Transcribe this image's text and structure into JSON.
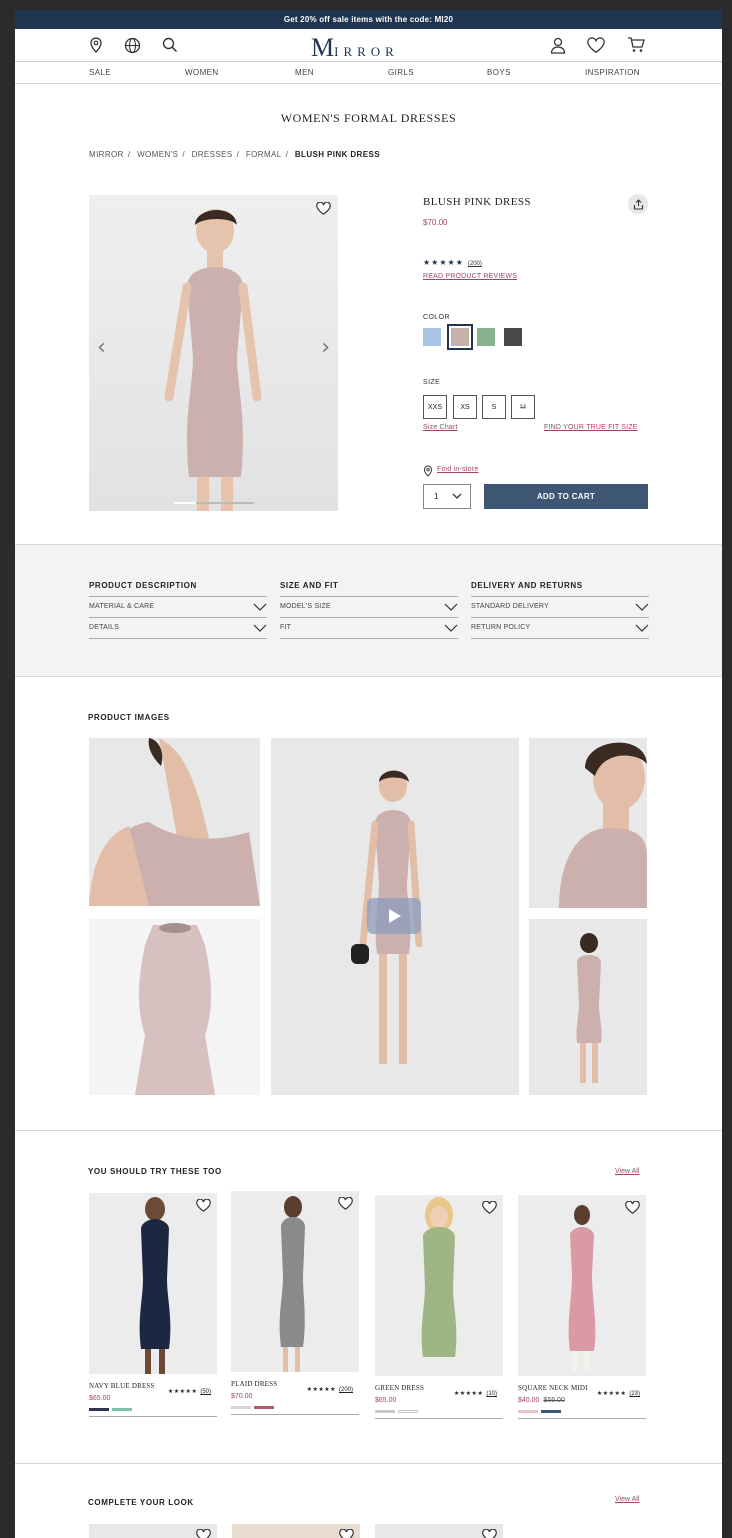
{
  "promo": "Get 20% off sale items with the code: MI20",
  "logo": {
    "initial": "M",
    "rest": "IRROR"
  },
  "nav": [
    "SALE",
    "WOMEN",
    "MEN",
    "GIRLS",
    "BOYS",
    "INSPIRATION"
  ],
  "page_title": "WOMEN'S FORMAL DRESSES",
  "breadcrumbs": [
    "MIRROR",
    "WOMEN'S",
    "DRESSES",
    "FORMAL",
    "BLUSH PINK DRESS"
  ],
  "product": {
    "name": "BLUSH PINK DRESS",
    "price": "$70.00",
    "stars": "★★★★★",
    "review_count": "(200)",
    "reviews_link": "READ PRODUCT REVIEWS",
    "color_label": "COLOR",
    "colors": [
      "#a9c4e4",
      "#c6b2ab",
      "#86b28d",
      "#4a4a4a"
    ],
    "size_label": "SIZE",
    "sizes": [
      "XXS",
      "XS",
      "S",
      "M"
    ],
    "size_chart": "Size Chart",
    "true_fit": "FIND YOUR TRUE FIT SIZE",
    "find_store": "Find in-store",
    "quantity": "1",
    "add_to_cart": "ADD TO CART"
  },
  "info": [
    {
      "heading": "PRODUCT DESCRIPTION",
      "rows": [
        "MATERIAL & CARE",
        "DETAILS"
      ]
    },
    {
      "heading": "SIZE AND FIT",
      "rows": [
        "MODEL'S SIZE",
        "FIT"
      ]
    },
    {
      "heading": "DELIVERY AND RETURNS",
      "rows": [
        "STANDARD DELIVERY",
        "RETURN POLICY"
      ]
    }
  ],
  "product_images_heading": "PRODUCT IMAGES",
  "recommend": {
    "heading": "YOU SHOULD TRY THESE TOO",
    "view_all": "View All",
    "items": [
      {
        "name": "NAVY BLUE DRESS",
        "price": "$65.00",
        "old_price": "",
        "stars": "★★★★★",
        "count": "(50)",
        "swatches": [
          "#2b3650",
          "#7fc3a6"
        ],
        "dress": "#1c2742"
      },
      {
        "name": "PLAID DRESS",
        "price": "$70.00",
        "old_price": "",
        "stars": "★★★★★",
        "count": "(200)",
        "swatches": [
          "#d6d6d6",
          "#b55a6a"
        ],
        "dress": "#8a8a8a"
      },
      {
        "name": "GREEN DRESS",
        "price": "$65.00",
        "old_price": "",
        "stars": "★★★★★",
        "count": "(10)",
        "swatches": [
          "#b7c9a4",
          "#ffffff"
        ],
        "dress": "#9db684"
      },
      {
        "name": "SQUARE NECK MIDI",
        "price": "$40.00",
        "old_price": "$55.00",
        "stars": "★★★★★",
        "count": "(23)",
        "swatches": [
          "#e8c4cc",
          "#3c5673"
        ],
        "dress": "#d99aa6"
      }
    ]
  },
  "complete_look": {
    "heading": "COMPLETE YOUR LOOK",
    "view_all": "View All"
  },
  "colors": {
    "navy": "#1f3550",
    "accent": "#a2435f",
    "button": "#3c5673"
  }
}
